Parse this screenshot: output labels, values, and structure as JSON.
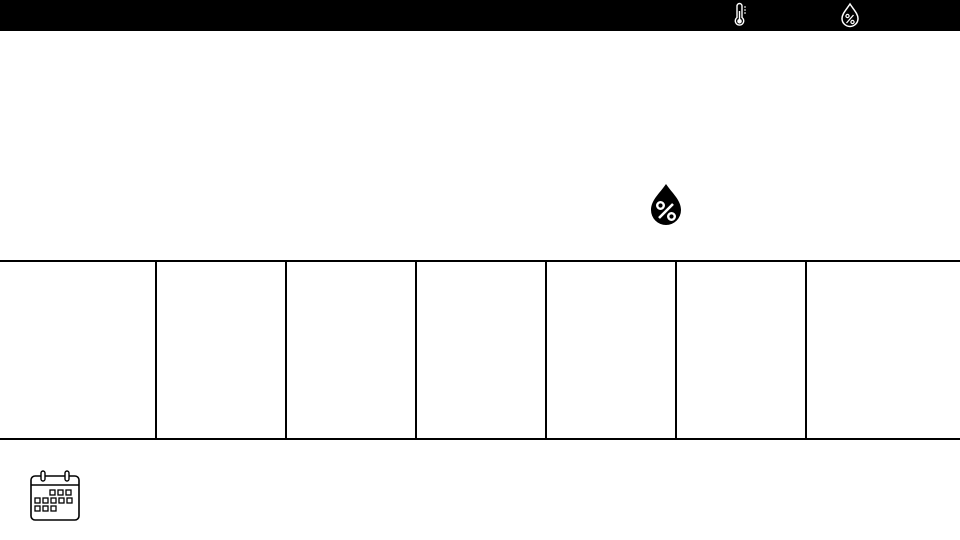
{
  "status_bar": {
    "background": "#000000",
    "icons": [
      "thermometer-icon",
      "humidity-percent-icon"
    ]
  },
  "current_conditions": {
    "icons": [
      "humidity-percent-icon"
    ]
  },
  "forecast": {
    "day_count": 7
  },
  "footer": {
    "icons": [
      "calendar-icon"
    ]
  }
}
